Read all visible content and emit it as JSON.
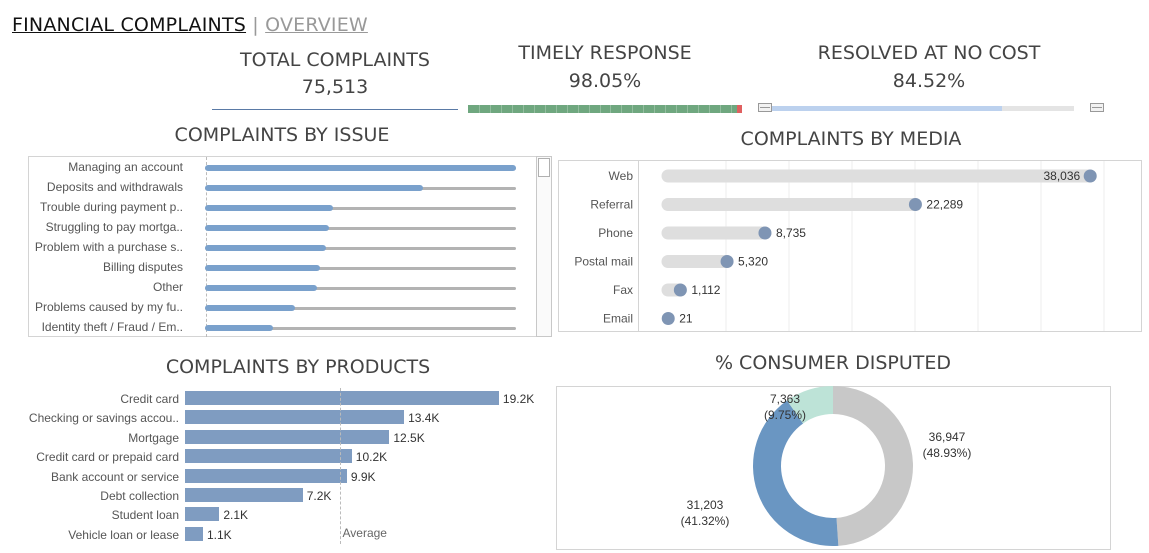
{
  "title": {
    "main": "FINANCIAL COMPLAINTS",
    "separator": " | ",
    "sub": "OVERVIEW"
  },
  "kpis": {
    "total": {
      "label": "TOTAL COMPLAINTS",
      "value": "75,513"
    },
    "timely": {
      "label": "TIMELY RESPONSE",
      "value": "98.05%",
      "fraction": 0.9805
    },
    "resolved": {
      "label": "RESOLVED AT NO COST",
      "value": "84.52%",
      "fraction": 0.8452
    }
  },
  "colors": {
    "bar_blue": "#7f9cc1",
    "issue_blue": "#7aa1cc",
    "issue_track": "#b3b3b3",
    "media_track": "#dedede",
    "media_dot": "#7f95b4",
    "timely_green": "#6fa77f",
    "timely_red": "#e06060",
    "resolved_blue": "#bcd1ee",
    "donut_gray": "#c8c8c8",
    "donut_blue": "#6a96c2",
    "donut_teal": "#bde3d7"
  },
  "chart_data": [
    {
      "type": "bar",
      "title": "COMPLAINTS BY ISSUE",
      "orientation": "horizontal",
      "categories": [
        "Managing an account",
        "Deposits and withdrawals",
        "Trouble during payment p..",
        "Struggling to pay mortga..",
        "Problem with a purchase s..",
        "Billing disputes",
        "Other",
        "Problems caused by my fu..",
        "Identity theft / Fraud / Em.."
      ],
      "values": [
        1.0,
        0.7,
        0.41,
        0.4,
        0.39,
        0.37,
        0.36,
        0.29,
        0.22
      ],
      "value_unit": "fraction of largest issue"
    },
    {
      "type": "scatter",
      "title": "COMPLAINTS BY MEDIA",
      "categories": [
        "Web",
        "Referral",
        "Phone",
        "Postal mail",
        "Fax",
        "Email"
      ],
      "values": [
        38036,
        22289,
        8735,
        5320,
        1112,
        21
      ],
      "labels": [
        "38,036",
        "22,289",
        "8,735",
        "5,320",
        "1,112",
        "21"
      ],
      "xlim": [
        0,
        40000
      ]
    },
    {
      "type": "bar",
      "title": "COMPLAINTS BY PRODUCTS",
      "orientation": "horizontal",
      "categories": [
        "Credit card",
        "Checking or savings accou..",
        "Mortgage",
        "Credit card or prepaid card",
        "Bank account or service",
        "Debt collection",
        "Student loan",
        "Vehicle loan or lease"
      ],
      "values": [
        19200,
        13400,
        12500,
        10200,
        9900,
        7200,
        2100,
        1100
      ],
      "labels": [
        "19.2K",
        "13.4K",
        "12.5K",
        "10.2K",
        "9.9K",
        "7.2K",
        "2.1K",
        "1.1K"
      ],
      "reference_line": {
        "label": "Average",
        "value": 9450
      },
      "xlim": [
        0,
        20000
      ]
    },
    {
      "type": "pie",
      "title": "% CONSUMER DISPUTED",
      "donut": true,
      "slices": [
        {
          "value": 36947,
          "pct": 48.93,
          "label": "36,947",
          "pct_label": "(48.93%)"
        },
        {
          "value": 31203,
          "pct": 41.32,
          "label": "31,203",
          "pct_label": "(41.32%)"
        },
        {
          "value": 7363,
          "pct": 9.75,
          "label": "7,363",
          "pct_label": "(9.75%)"
        }
      ]
    }
  ]
}
